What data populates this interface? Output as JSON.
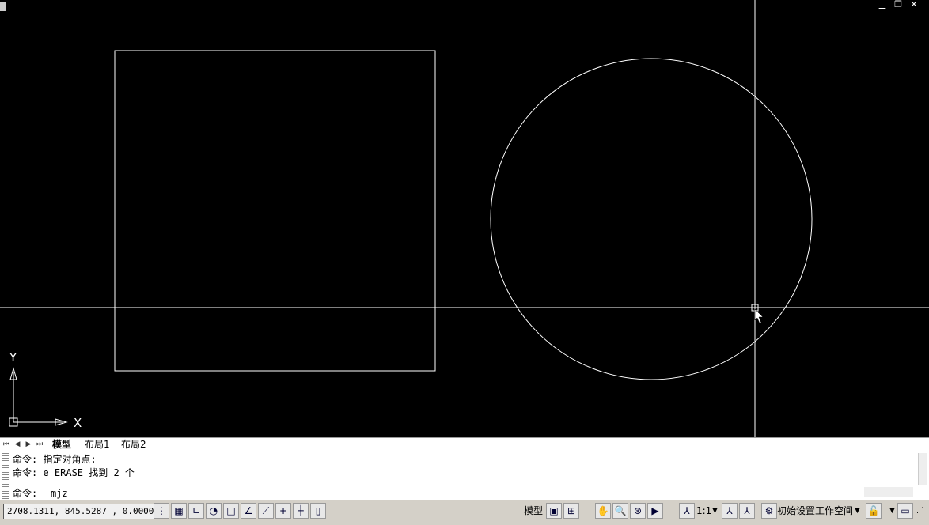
{
  "window": {
    "minimize_icon": "▁",
    "restore_icon": "❐",
    "close_icon": "✕"
  },
  "axes": {
    "y_label": "Y",
    "x_label": "X"
  },
  "tabs": [
    {
      "label": "模型"
    },
    {
      "label": "布局1"
    },
    {
      "label": "布局2"
    }
  ],
  "command": {
    "history": [
      "命令: 指定对角点:",
      "命令: e ERASE 找到 2 个"
    ],
    "prompt": "命令: ",
    "input_value": "mjz"
  },
  "status": {
    "coordinates": "2708.1311, 845.5287 , 0.0000",
    "model_label": "模型",
    "scale_label": "1:1",
    "workspace_label": "初始设置工作空间"
  }
}
